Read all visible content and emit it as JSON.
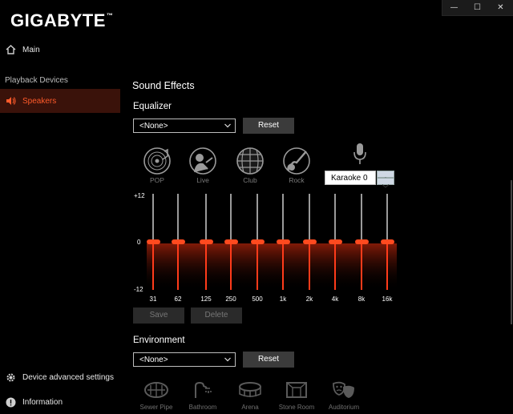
{
  "brand": {
    "name": "GIGABYTE",
    "mark": "™"
  },
  "window_controls": {
    "minimize": "—",
    "maximize": "☐",
    "close": "✕"
  },
  "sidebar": {
    "main": {
      "label": "Main",
      "icon": "home-icon"
    },
    "playback_section": "Playback Devices",
    "speakers": {
      "label": "Speakers",
      "icon": "speaker-icon",
      "active": true
    },
    "advanced": {
      "label": "Device advanced settings",
      "icon": "gear-icon"
    },
    "information": {
      "label": "Information",
      "icon": "info-icon"
    }
  },
  "sound_effects": {
    "title": "Sound Effects",
    "equalizer_label": "Equalizer",
    "equalizer_select": "<None>",
    "reset_label": "Reset",
    "presets": [
      {
        "label": "POP",
        "icon": "vinyl-record-icon"
      },
      {
        "label": "Live",
        "icon": "singer-icon"
      },
      {
        "label": "Club",
        "icon": "disco-ball-icon"
      },
      {
        "label": "Rock",
        "icon": "guitar-icon"
      }
    ],
    "karaoke": {
      "icon": "microphone-icon",
      "value": "Karaoke 0"
    },
    "eq": {
      "top_label": "+12",
      "mid_label": "0",
      "bottom_label": "-12",
      "bands": [
        {
          "freq": "31",
          "gain": 0
        },
        {
          "freq": "62",
          "gain": 0
        },
        {
          "freq": "125",
          "gain": 0
        },
        {
          "freq": "250",
          "gain": 0
        },
        {
          "freq": "500",
          "gain": 0
        },
        {
          "freq": "1k",
          "gain": 0
        },
        {
          "freq": "2k",
          "gain": 0
        },
        {
          "freq": "4k",
          "gain": 0
        },
        {
          "freq": "8k",
          "gain": 0
        },
        {
          "freq": "16k",
          "gain": 0
        }
      ]
    },
    "save_label": "Save",
    "delete_label": "Delete"
  },
  "environment": {
    "label": "Environment",
    "select": "<None>",
    "reset_label": "Reset",
    "presets": [
      {
        "label": "Sewer Pipe",
        "icon": "sewer-pipe-icon"
      },
      {
        "label": "Bathroom",
        "icon": "shower-icon"
      },
      {
        "label": "Arena",
        "icon": "arena-icon"
      },
      {
        "label": "Stone Room",
        "icon": "stone-room-icon"
      },
      {
        "label": "Auditorium",
        "icon": "theater-masks-icon"
      }
    ]
  },
  "colors": {
    "accent": "#ff4a1f",
    "active_bg": "#3a120a",
    "button_bg": "#3b3b3b"
  }
}
